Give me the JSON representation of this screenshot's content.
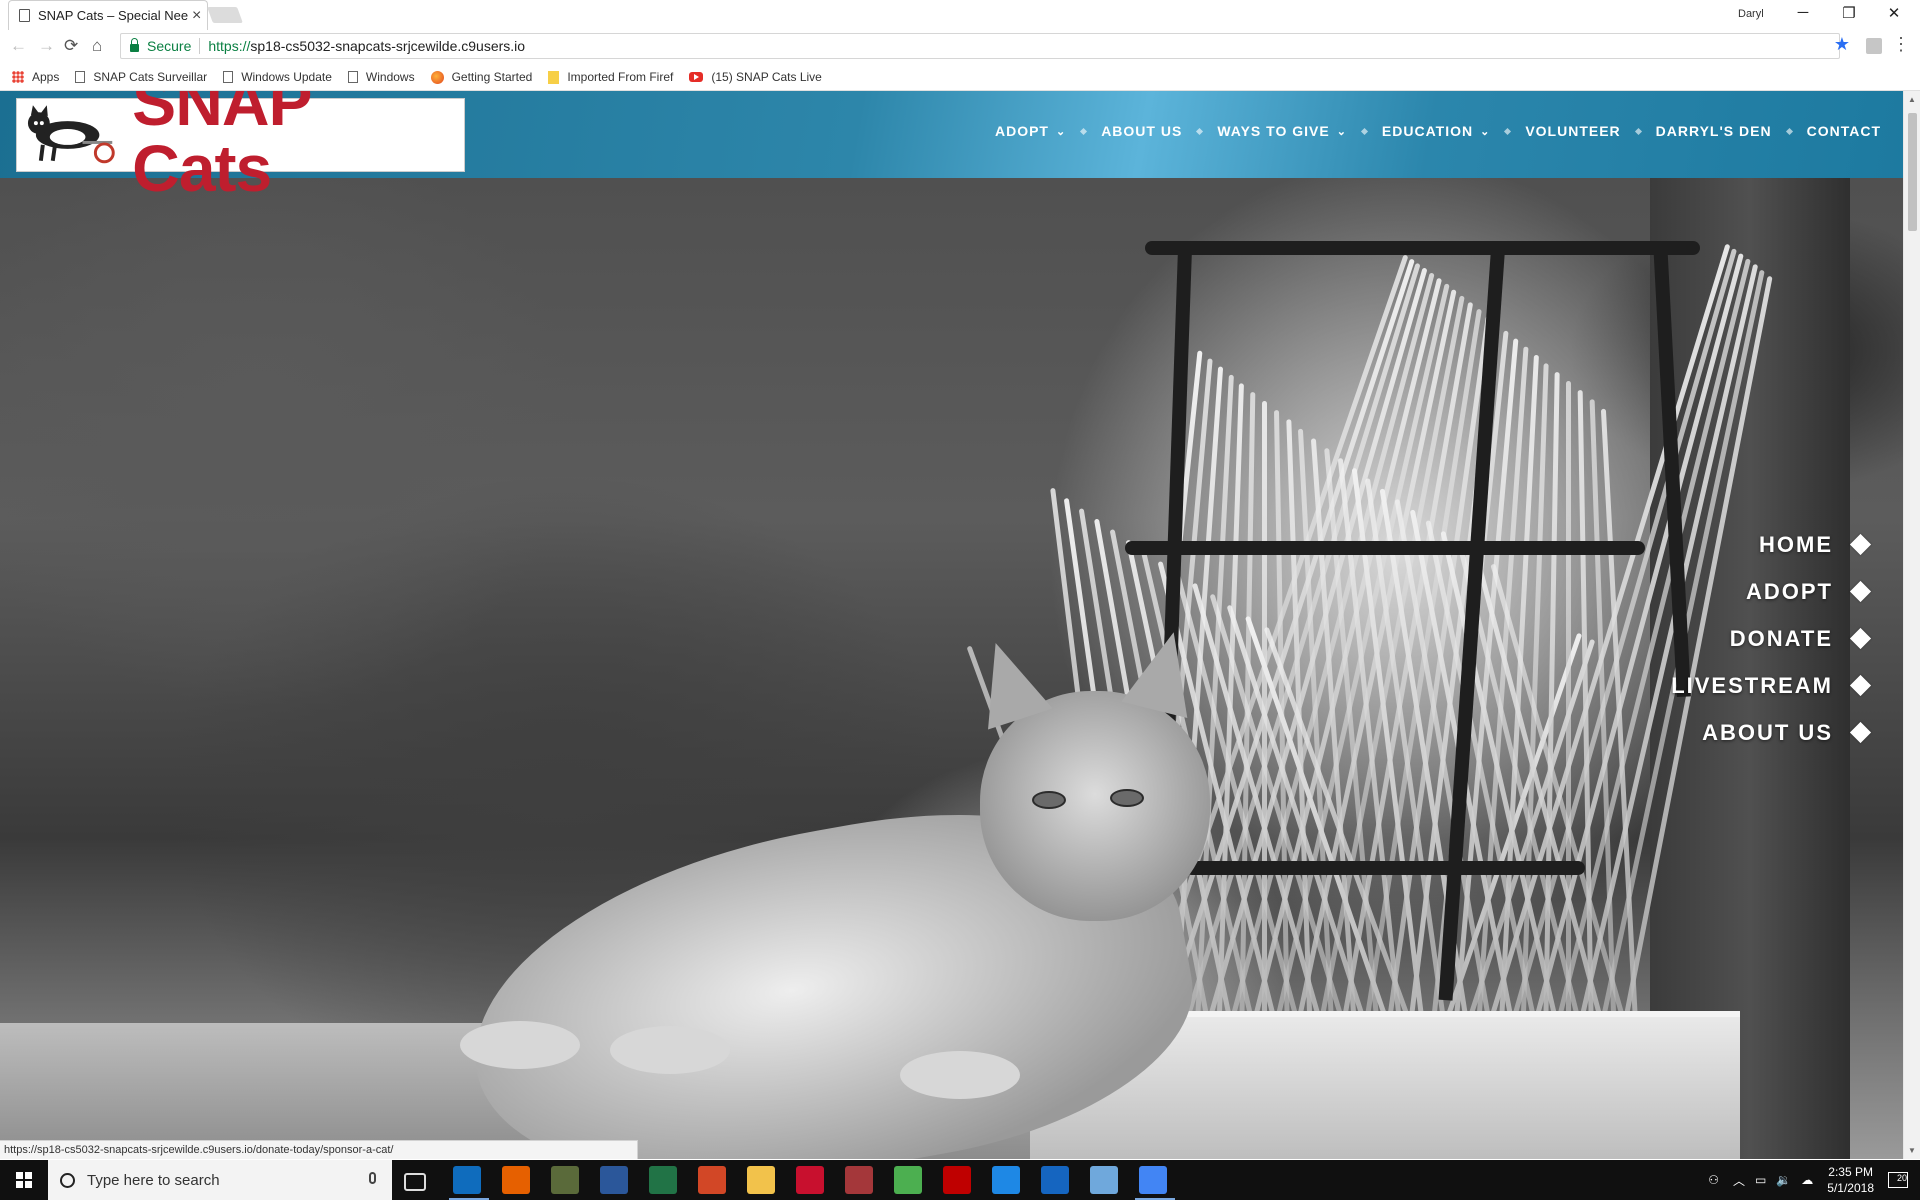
{
  "browser": {
    "tab_title": "SNAP Cats – Special Nee",
    "tab_close": "×",
    "window_user": "Daryl",
    "controls": {
      "minimize": "─",
      "restore": "❐",
      "close": "✕"
    },
    "nav": {
      "back": "←",
      "forward": "→",
      "reload": "⟳",
      "home": "⌂"
    },
    "secure_label": "Secure",
    "url_scheme": "https://",
    "url_rest": "sp18-cs5032-snapcats-srjcewilde.c9users.io",
    "star": "★",
    "menu": "⋮",
    "bookmarks": [
      {
        "label": "Apps",
        "icon": "apps-grid-icon"
      },
      {
        "label": "SNAP Cats Surveillar",
        "icon": "page-icon"
      },
      {
        "label": "Windows Update",
        "icon": "page-icon"
      },
      {
        "label": "Windows",
        "icon": "page-icon"
      },
      {
        "label": "Getting Started",
        "icon": "firefox-icon"
      },
      {
        "label": "Imported From Firef",
        "icon": "folder-icon"
      },
      {
        "label": "(15) SNAP Cats Live",
        "icon": "youtube-icon"
      }
    ],
    "status_url": "https://sp18-cs5032-snapcats-srjcewilde.c9users.io/donate-today/sponsor-a-cat/"
  },
  "site": {
    "logo_text": "SNAP Cats",
    "header_colors": {
      "primary": "#2d86aa",
      "logo_red": "#bf1e2e"
    },
    "nav": [
      {
        "label": "ADOPT",
        "chevron": "⌄"
      },
      {
        "label": "ABOUT US",
        "chevron": ""
      },
      {
        "label": "WAYS TO GIVE",
        "chevron": "⌄"
      },
      {
        "label": "EDUCATION",
        "chevron": "⌄"
      },
      {
        "label": "VOLUNTEER",
        "chevron": ""
      },
      {
        "label": "DARRYL'S DEN",
        "chevron": ""
      },
      {
        "label": "CONTACT",
        "chevron": ""
      }
    ],
    "dot_nav": [
      {
        "label": "HOME"
      },
      {
        "label": "ADOPT"
      },
      {
        "label": "DONATE"
      },
      {
        "label": "LIVESTREAM"
      },
      {
        "label": "ABOUT US"
      }
    ]
  },
  "taskbar": {
    "search_placeholder": "Type here to search",
    "time": "2:35 PM",
    "date": "5/1/2018",
    "notifications": "20",
    "apps": [
      {
        "name": "task-view-icon",
        "color": "#101010"
      },
      {
        "name": "outlook-icon",
        "color": "#0f6cbd"
      },
      {
        "name": "firefox-icon",
        "color": "#e66000"
      },
      {
        "name": "game-icon",
        "color": "#5a6a3a"
      },
      {
        "name": "word-icon",
        "color": "#2b579a"
      },
      {
        "name": "excel-icon",
        "color": "#217346"
      },
      {
        "name": "powerpoint-icon",
        "color": "#d24726"
      },
      {
        "name": "file-explorer-icon",
        "color": "#f2c24b"
      },
      {
        "name": "acrobat-icon",
        "color": "#c8102e"
      },
      {
        "name": "access-icon",
        "color": "#a4373a"
      },
      {
        "name": "app-green-icon",
        "color": "#4caf50"
      },
      {
        "name": "filezilla-icon",
        "color": "#bf0000"
      },
      {
        "name": "edge-icon",
        "color": "#1e88e5"
      },
      {
        "name": "malwarebytes-icon",
        "color": "#1565c0"
      },
      {
        "name": "scanner-icon",
        "color": "#6fa8dc"
      },
      {
        "name": "chrome-icon",
        "color": "#4285f4"
      }
    ]
  }
}
